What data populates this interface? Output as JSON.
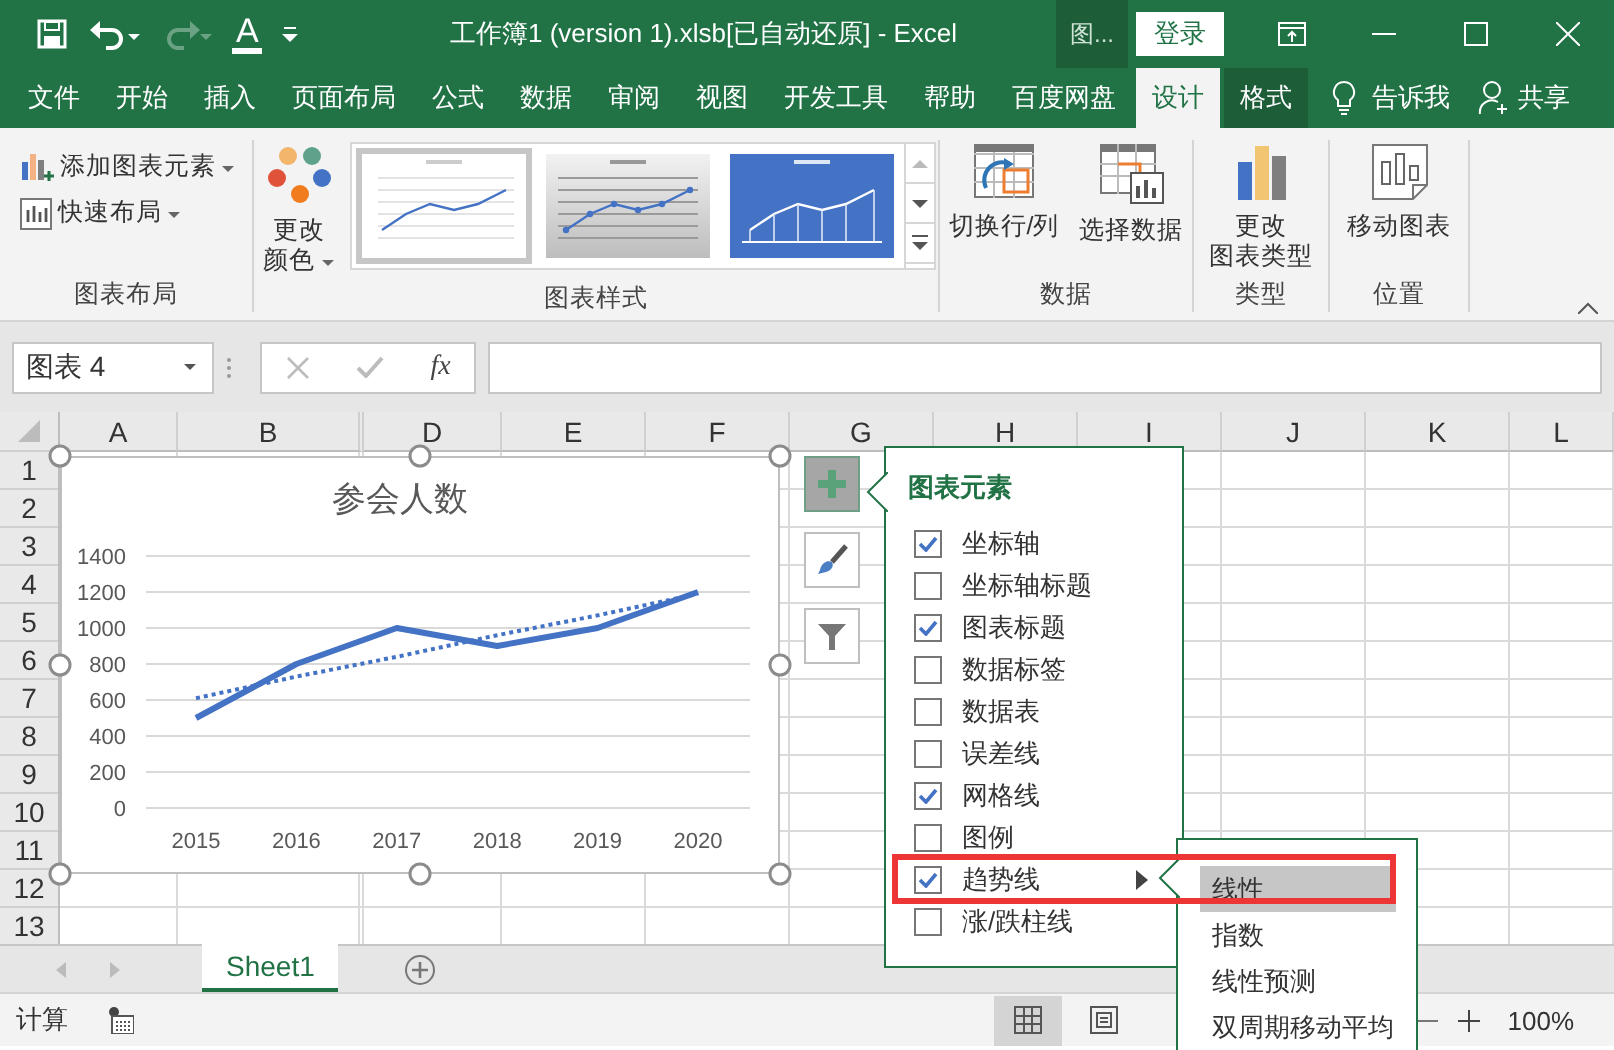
{
  "title_bar": {
    "quick_access": [
      {
        "kind": "save",
        "disabled": false
      },
      {
        "kind": "undo",
        "disabled": false
      },
      {
        "kind": "redo",
        "disabled": true
      },
      {
        "kind": "font-color",
        "glyph": "A",
        "disabled": false
      },
      {
        "kind": "customize",
        "disabled": false
      }
    ],
    "title": "工作簿1 (version 1).xlsb[已自动还原]  -  Excel",
    "context_label": "图...",
    "sign_in": "登录",
    "window_controls": [
      {
        "kind": "ribbon-display"
      },
      {
        "kind": "minimize"
      },
      {
        "kind": "maximize"
      },
      {
        "kind": "close"
      }
    ]
  },
  "ribbon_tabs": [
    {
      "label": "文件",
      "kind": "normal",
      "selected": false
    },
    {
      "label": "开始",
      "kind": "normal",
      "selected": false
    },
    {
      "label": "插入",
      "kind": "normal",
      "selected": false
    },
    {
      "label": "页面布局",
      "kind": "normal",
      "selected": false
    },
    {
      "label": "公式",
      "kind": "normal",
      "selected": false
    },
    {
      "label": "数据",
      "kind": "normal",
      "selected": false
    },
    {
      "label": "审阅",
      "kind": "normal",
      "selected": false
    },
    {
      "label": "视图",
      "kind": "normal",
      "selected": false
    },
    {
      "label": "开发工具",
      "kind": "normal",
      "selected": false
    },
    {
      "label": "帮助",
      "kind": "normal",
      "selected": false
    },
    {
      "label": "百度网盘",
      "kind": "normal",
      "selected": false
    },
    {
      "label": "设计",
      "kind": "context",
      "selected": true
    },
    {
      "label": "格式",
      "kind": "context",
      "selected": false
    }
  ],
  "tell_me": "告诉我",
  "share": "共享",
  "ribbon_groups": [
    {
      "label": "图表布局",
      "commands": [
        {
          "kind": "add-element",
          "lines": [
            "添加图表元素"
          ],
          "dropdown": true
        },
        {
          "kind": "quick-layout",
          "lines": [
            "快速布局"
          ],
          "dropdown": true
        }
      ]
    },
    {
      "label": "图表样式",
      "commands": [
        {
          "kind": "colors",
          "lines": [
            "更改",
            "颜色"
          ],
          "dropdown": true
        }
      ],
      "gallery": [
        {
          "kind": "plain",
          "selected": true
        },
        {
          "kind": "gray",
          "selected": false
        },
        {
          "kind": "blue",
          "selected": false
        }
      ]
    },
    {
      "label": "数据",
      "commands": [
        {
          "kind": "switch",
          "lines": [
            "切换行/列"
          ],
          "dropdown": false
        },
        {
          "kind": "select-data",
          "lines": [
            "选择数据"
          ],
          "dropdown": false
        }
      ]
    },
    {
      "label": "类型",
      "commands": [
        {
          "kind": "chart-type",
          "lines": [
            "更改",
            "图表类型"
          ],
          "dropdown": false
        }
      ]
    },
    {
      "label": "位置",
      "commands": [
        {
          "kind": "move-chart",
          "lines": [
            "移动图表"
          ],
          "dropdown": false
        }
      ]
    }
  ],
  "formula_bar": {
    "name_box": "图表 4",
    "buttons": [
      {
        "kind": "cancel",
        "disabled": true
      },
      {
        "kind": "enter",
        "disabled": true
      },
      {
        "kind": "function",
        "glyph": "fx",
        "disabled": false
      }
    ]
  },
  "sheet": {
    "columns": [
      "A",
      "B",
      "D",
      "E",
      "F",
      "G",
      "H",
      "I",
      "J",
      "K",
      "L"
    ],
    "rows": [
      "1",
      "2",
      "3",
      "4",
      "5",
      "6",
      "7",
      "8",
      "9",
      "10",
      "11",
      "12",
      "13"
    ]
  },
  "chart": {
    "selected": true,
    "chart_data": {
      "type": "line",
      "title": "参会人数",
      "categories": [
        "2015",
        "2016",
        "2017",
        "2018",
        "2019",
        "2020"
      ],
      "series": [
        {
          "color": "#4472c4",
          "line_style": "solid",
          "values": [
            500,
            800,
            1000,
            900,
            1000,
            1200
          ]
        },
        {
          "color": "#4472c4",
          "line_style": "dotted",
          "values": [
            610,
            730,
            840,
            960,
            1070,
            1190
          ]
        }
      ],
      "ylim": [
        0,
        1400
      ],
      "yticks": [
        0,
        200,
        400,
        600,
        800,
        1000,
        1200,
        1400
      ],
      "grid": true
    }
  },
  "chart_tools": [
    {
      "kind": "elements",
      "selected": true
    },
    {
      "kind": "styles",
      "selected": false
    },
    {
      "kind": "filter",
      "selected": false
    }
  ],
  "elements_panel": {
    "title": "图表元素",
    "items": [
      {
        "label": "坐标轴",
        "checked": true,
        "has_submenu": false,
        "highlighted": false
      },
      {
        "label": "坐标轴标题",
        "checked": false,
        "has_submenu": false,
        "highlighted": false
      },
      {
        "label": "图表标题",
        "checked": true,
        "has_submenu": false,
        "highlighted": false
      },
      {
        "label": "数据标签",
        "checked": false,
        "has_submenu": false,
        "highlighted": false
      },
      {
        "label": "数据表",
        "checked": false,
        "has_submenu": false,
        "highlighted": false
      },
      {
        "label": "误差线",
        "checked": false,
        "has_submenu": false,
        "highlighted": false
      },
      {
        "label": "网格线",
        "checked": true,
        "has_submenu": false,
        "highlighted": false
      },
      {
        "label": "图例",
        "checked": false,
        "has_submenu": false,
        "highlighted": false
      },
      {
        "label": "趋势线",
        "checked": true,
        "has_submenu": true,
        "highlighted": true
      },
      {
        "label": "涨/跌柱线",
        "checked": false,
        "has_submenu": false,
        "highlighted": false
      }
    ]
  },
  "trendline_menu": {
    "items": [
      {
        "label": "线性",
        "selected": true
      },
      {
        "label": "指数",
        "selected": false
      },
      {
        "label": "线性预测",
        "selected": false
      },
      {
        "label": "双周期移动平均",
        "selected": false
      }
    ]
  },
  "sheet_tabs": [
    {
      "label": "Sheet1",
      "selected": true
    }
  ],
  "status_bar": {
    "mode": "计算",
    "views": [
      {
        "kind": "normal",
        "selected": true
      },
      {
        "kind": "page-layout",
        "selected": false
      }
    ],
    "zoom": "100%"
  }
}
